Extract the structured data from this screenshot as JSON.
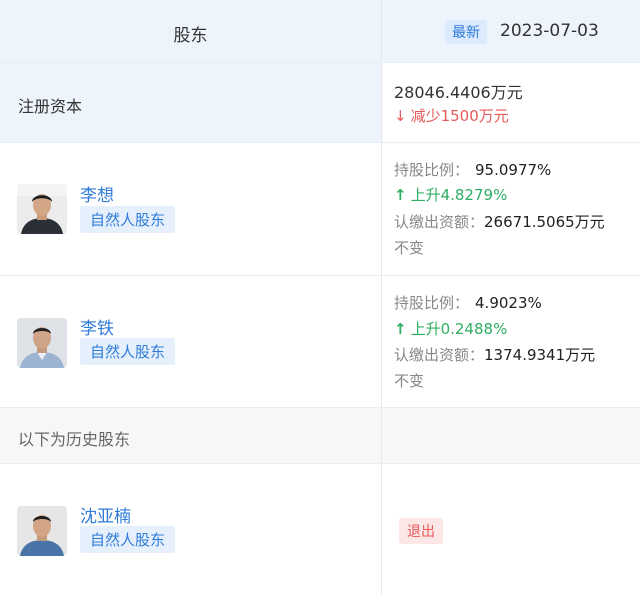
{
  "header": {
    "shareholder_label": "股东",
    "latest_badge": "最新",
    "date": "2023-07-03"
  },
  "capital": {
    "label": "注册资本",
    "amount": "28046.4406万元",
    "change_arrow": "↓",
    "change_text": "减少1500万元"
  },
  "shareholders": [
    {
      "name": "李想",
      "type": "自然人股东",
      "ratio_label": "持股比例：",
      "ratio_value": "95.0977%",
      "change_arrow": "↑",
      "change_text": "上升4.8279%",
      "subscribed_label": "认缴出资额：",
      "subscribed_value": "26671.5065万元",
      "subscribed_change": "不变"
    },
    {
      "name": "李铁",
      "type": "自然人股东",
      "ratio_label": "持股比例：",
      "ratio_value": "4.9023%",
      "change_arrow": "↑",
      "change_text": "上升0.2488%",
      "subscribed_label": "认缴出资额：",
      "subscribed_value": "1374.9341万元",
      "subscribed_change": "不变"
    }
  ],
  "history": {
    "label": "以下为历史股东",
    "shareholders": [
      {
        "name": "沈亚楠",
        "type": "自然人股东",
        "status": "退出"
      }
    ]
  },
  "colors": {
    "accent_blue": "#2f7bd9",
    "up_green": "#2fae63",
    "down_red": "#e8595a"
  }
}
